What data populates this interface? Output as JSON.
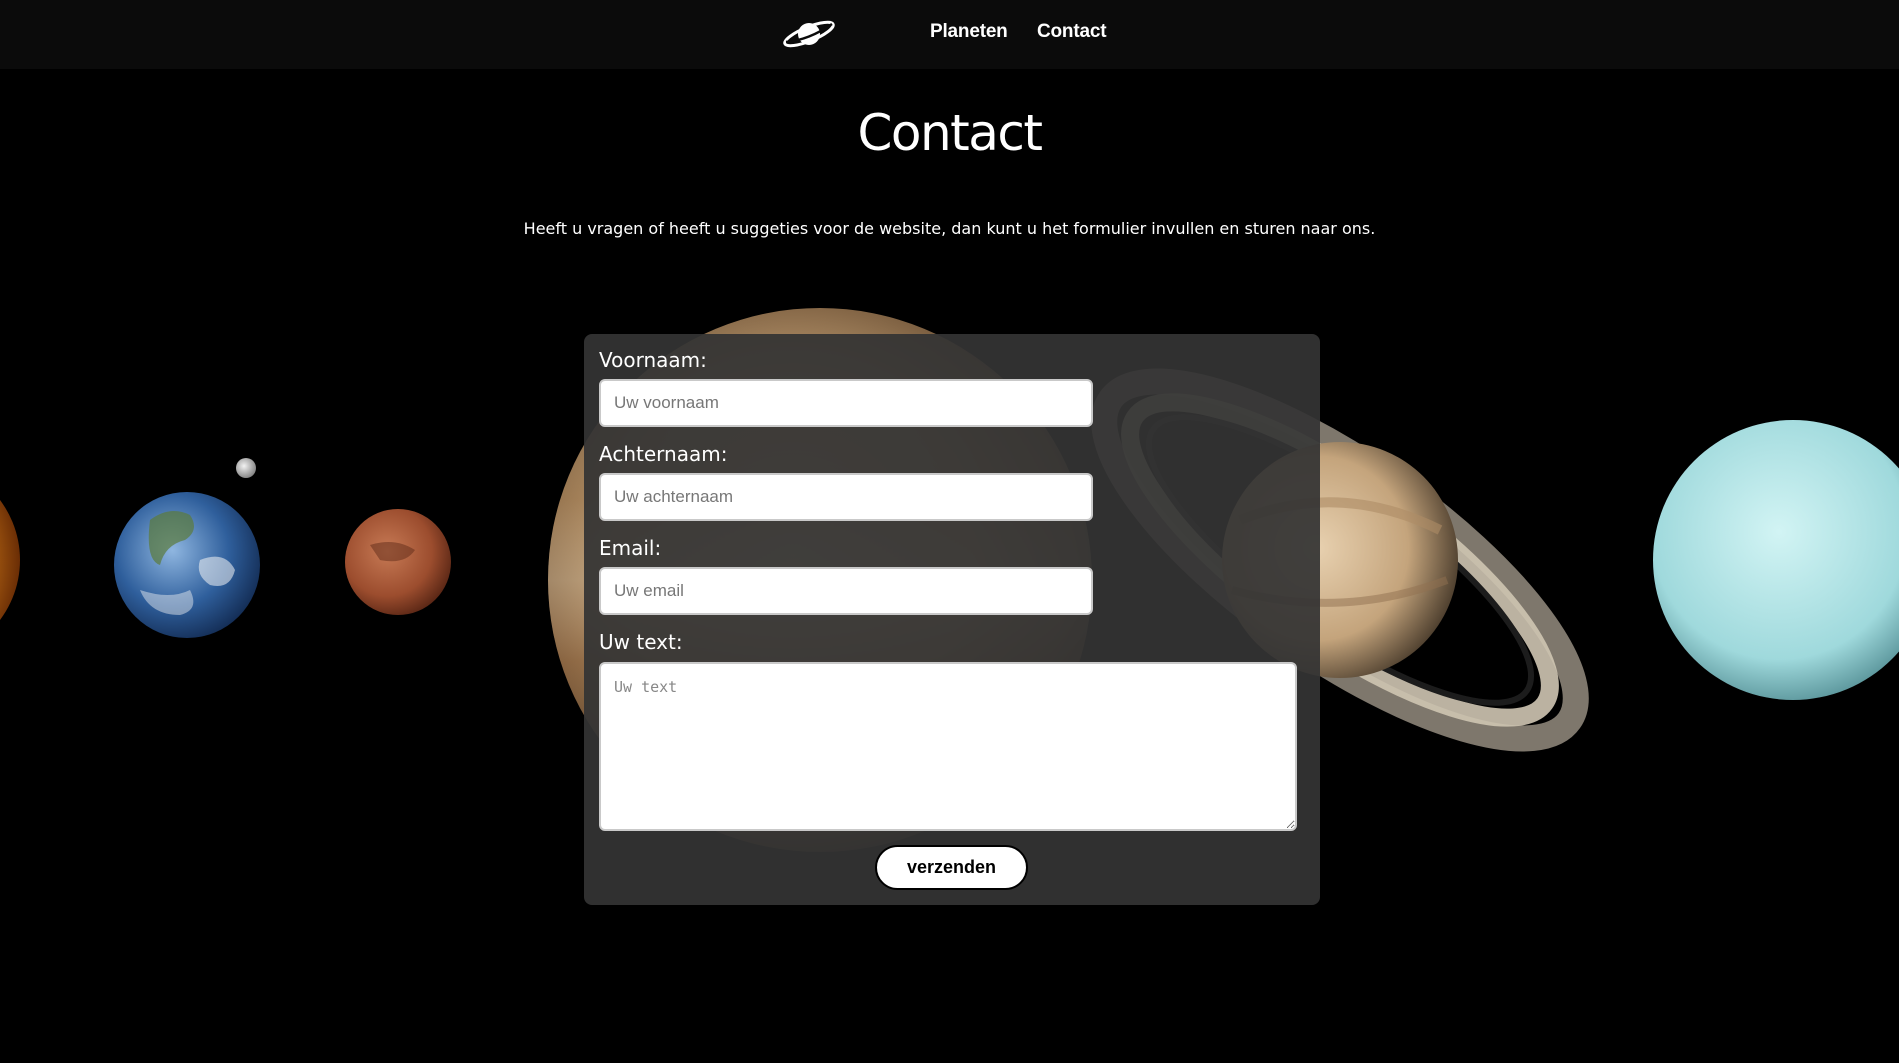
{
  "nav": {
    "logo_icon": "saturn-logo-icon",
    "links": [
      {
        "label": "Planeten"
      },
      {
        "label": "Contact"
      }
    ]
  },
  "main": {
    "title": "Contact",
    "intro": "Heeft u vragen of heeft u suggeties voor de website, dan kunt u het formulier invullen en sturen naar ons."
  },
  "form": {
    "first_name": {
      "label": "Voornaam:",
      "placeholder": "Uw voornaam",
      "value": ""
    },
    "last_name": {
      "label": "Achternaam:",
      "placeholder": "Uw achternaam",
      "value": ""
    },
    "email": {
      "label": "Email:",
      "placeholder": "Uw email",
      "value": ""
    },
    "message": {
      "label": "Uw text:",
      "placeholder": "Uw text",
      "value": ""
    },
    "submit_label": "verzenden"
  },
  "background": {
    "images": [
      "sun-image",
      "moon-image",
      "earth-image",
      "mars-image",
      "jupiter-image",
      "saturn-image",
      "uranus-image"
    ]
  },
  "colors": {
    "page_background": "#000000",
    "navbar_background": "#0b0b0b",
    "form_card_background": "#343434",
    "text": "#ffffff",
    "button_background": "#ffffff",
    "button_text": "#000000"
  }
}
